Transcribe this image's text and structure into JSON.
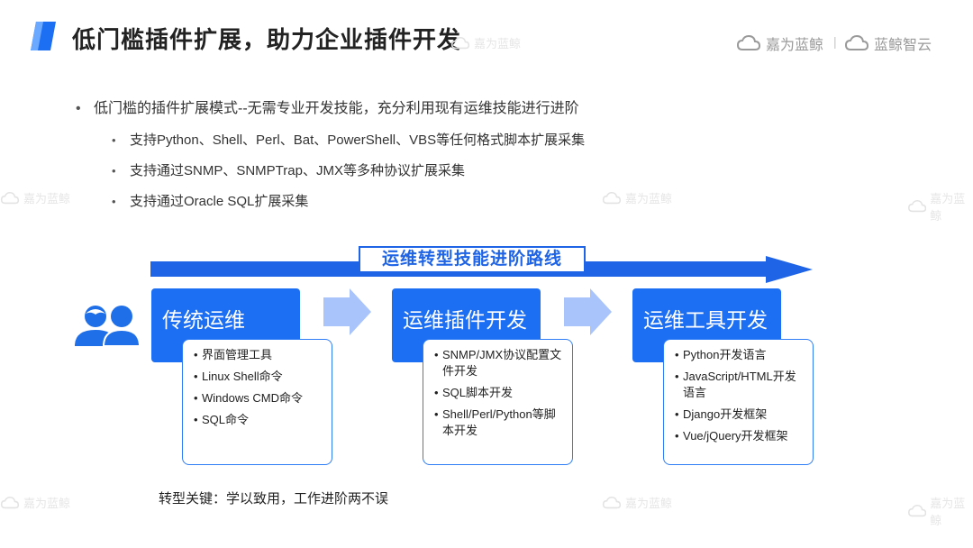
{
  "header": {
    "title": "低门槛插件扩展，助力企业插件开发",
    "brand_primary": "嘉为蓝鲸",
    "brand_secondary": "蓝鲸智云",
    "separator": "|"
  },
  "watermark_text": "嘉为蓝鲸",
  "bullets": {
    "main": "低门槛的插件扩展模式--无需专业开发技能，充分利用现有运维技能进行进阶",
    "sub": [
      "支持Python、Shell、Perl、Bat、PowerShell、VBS等任何格式脚本扩展采集",
      "支持通过SNMP、SNMPTrap、JMX等多种协议扩展采集",
      "支持通过Oracle SQL扩展采集"
    ]
  },
  "route": {
    "label": "运维转型技能进阶路线"
  },
  "stages": [
    {
      "title": "传统运维",
      "items": [
        "界面管理工具",
        "Linux Shell命令",
        "Windows CMD命令",
        "SQL命令"
      ]
    },
    {
      "title": "运维插件开发",
      "items": [
        "SNMP/JMX协议配置文件开发",
        "SQL脚本开发",
        "Shell/Perl/Python等脚本开发"
      ]
    },
    {
      "title": "运维工具开发",
      "items": [
        "Python开发语言",
        "JavaScript/HTML开发语言",
        "Django开发框架",
        "Vue/jQuery开发框架"
      ]
    }
  ],
  "footer_note": "转型关键：学以致用，工作进阶两不误",
  "colors": {
    "accent": "#1c6ef2",
    "route_arrow": "#1f64e6",
    "step_arrow": "#a9c3fb",
    "people_icon": "#1f6fe8"
  },
  "icons": {
    "logo": "logo-mark-icon",
    "brand": "cloud-icon",
    "people": "people-icon",
    "step": "chevron-arrow-icon"
  }
}
